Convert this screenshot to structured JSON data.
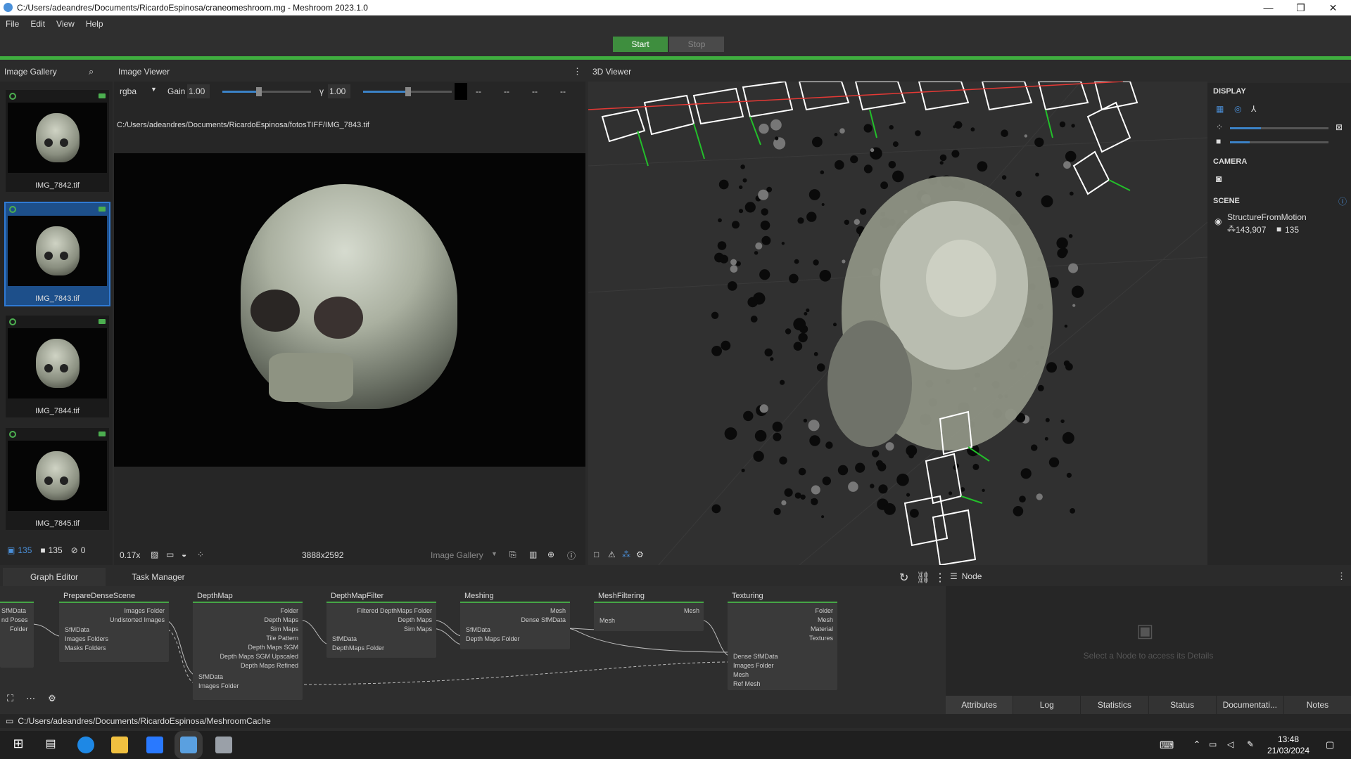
{
  "window": {
    "title": "C:/Users/adeandres/Documents/RicardoEspinosa/craneomeshroom.mg - Meshroom 2023.1.0"
  },
  "menu": [
    "File",
    "Edit",
    "View",
    "Help"
  ],
  "toolbar": {
    "start": "Start",
    "stop": "Stop"
  },
  "gallery": {
    "title": "Image Gallery",
    "images": [
      "IMG_7842.tif",
      "IMG_7843.tif",
      "IMG_7844.tif",
      "IMG_7845.tif"
    ],
    "selected_index": 1,
    "footer": {
      "images": "135",
      "cameras": "135",
      "no_intrinsics": "0"
    }
  },
  "viewer": {
    "title": "Image Viewer",
    "channel": "rgba",
    "gain_label": "Gain",
    "gain": "1.00",
    "gamma_label": "γ",
    "gamma": "1.00",
    "swatch": [
      "--",
      "--",
      "--",
      "--"
    ],
    "path": "C:/Users/adeandres/Documents/RicardoEspinosa/fotosTIFF/IMG_7843.tif",
    "zoom": "0.17x",
    "resolution": "3888x2592",
    "source": "Image Gallery"
  },
  "viewer3d": {
    "title": "3D Viewer"
  },
  "rightpanel": {
    "display": "DISPLAY",
    "camera": "CAMERA",
    "scene": "SCENE",
    "scene_item": "StructureFromMotion",
    "points": "143,907",
    "cams": "135"
  },
  "graph": {
    "tabs": [
      "Graph Editor",
      "Task Manager"
    ],
    "nodes": {
      "partial": {
        "inputs": [
          "SfMData",
          "nd Poses",
          "Folder"
        ]
      },
      "prepare": {
        "title": "PrepareDenseScene",
        "outputs": [
          "Images Folder",
          "Undistorted Images"
        ],
        "inputs": [
          "SfMData",
          "Images Folders",
          "Masks Folders"
        ]
      },
      "depthmap": {
        "title": "DepthMap",
        "outputs": [
          "Folder",
          "Depth Maps",
          "Sim Maps",
          "Tile Pattern",
          "Depth Maps SGM",
          "Depth Maps SGM Upscaled",
          "Depth Maps Refined"
        ],
        "inputs": [
          "SfMData",
          "Images Folder"
        ]
      },
      "depthfilter": {
        "title": "DepthMapFilter",
        "outputs": [
          "Filtered DepthMaps Folder",
          "Depth Maps",
          "Sim Maps"
        ],
        "inputs": [
          "SfMData",
          "DepthMaps Folder"
        ]
      },
      "meshing": {
        "title": "Meshing",
        "outputs": [
          "Mesh",
          "Dense SfMData"
        ],
        "inputs": [
          "SfMData",
          "Depth Maps Folder"
        ]
      },
      "meshfiltering": {
        "title": "MeshFiltering",
        "outputs": [
          "Mesh"
        ],
        "inputs": [
          "Mesh"
        ]
      },
      "texturing": {
        "title": "Texturing",
        "outputs": [
          "Folder",
          "Mesh",
          "Material",
          "Textures"
        ],
        "inputs": [
          "Dense SfMData",
          "Images Folder",
          "Mesh",
          "Ref Mesh"
        ]
      }
    }
  },
  "node_panel": {
    "title": "Node",
    "placeholder": "Select a Node to access its Details",
    "tabs": [
      "Attributes",
      "Log",
      "Statistics",
      "Status",
      "Documentati...",
      "Notes"
    ]
  },
  "statusbar": {
    "path": "C:/Users/adeandres/Documents/RicardoEspinosa/MeshroomCache"
  },
  "taskbar": {
    "time": "13:48",
    "date": "21/03/2024"
  }
}
